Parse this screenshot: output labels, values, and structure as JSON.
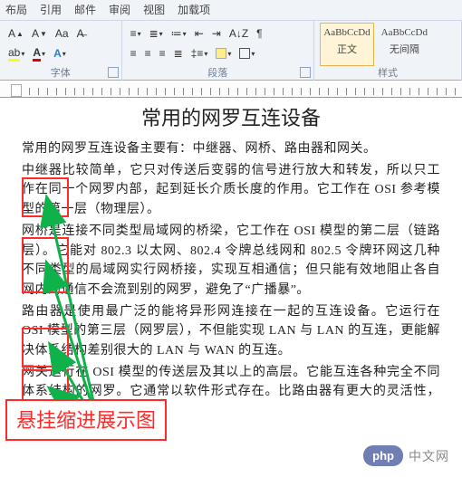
{
  "ribbon": {
    "tabs": [
      "布局",
      "引用",
      "邮件",
      "审阅",
      "视图",
      "加载项"
    ],
    "font_group": {
      "label": "字体",
      "icons": [
        "Aa",
        "A",
        "A"
      ]
    },
    "para_group": {
      "label": "段落"
    },
    "style_group": {
      "label": "样式",
      "items": [
        {
          "preview": "AaBbCcDd",
          "name": "正文"
        },
        {
          "preview": "AaBbCcDd",
          "name": "无间隔"
        }
      ]
    }
  },
  "doc": {
    "title": "常用的网罗互连设备",
    "p1": "常用的网罗互连设备主要有：中继器、网桥、路由器和网关。",
    "p2": "中继器比较简单，它只对传送后变弱的信号进行放大和转发，所以只工作在同一个网罗内部，起到延长介质长度的作用。它工作在 OSI 参考模型的第一层（物理层）。",
    "p3": "网桥是连接不同类型局域网的桥梁，它工作在 OSI 模型的第二层（链路层）。它能对 802.3 以太网、802.4 令牌总线网和 802.5 令牌环网这几种不同类型的局域网实行网桥接，实现互相通信；但只能有效地阻止各自网内的通信不会流到别的网罗，避免了“广播暴”。",
    "p4": "路由器是使用最广泛的能将异形网连接在一起的互连设备。它运行在 OSI 模型的第三层（网罗层），不但能实现 LAN 与 LAN 的互连，更能解决体系结构差别很大的 LAN 与 WAN 的互连。",
    "p5": "网关运行在 OSI 模型的传送层及其以上的高层。它能互连各种完全不同体系结构的网罗。它通常以软件形式存在。比路由器有更大的灵活性，但也更复杂、开销更大。"
  },
  "annotation": {
    "callout": "悬挂缩进展示图"
  },
  "watermark": {
    "pill": "php",
    "text": "中文网"
  }
}
